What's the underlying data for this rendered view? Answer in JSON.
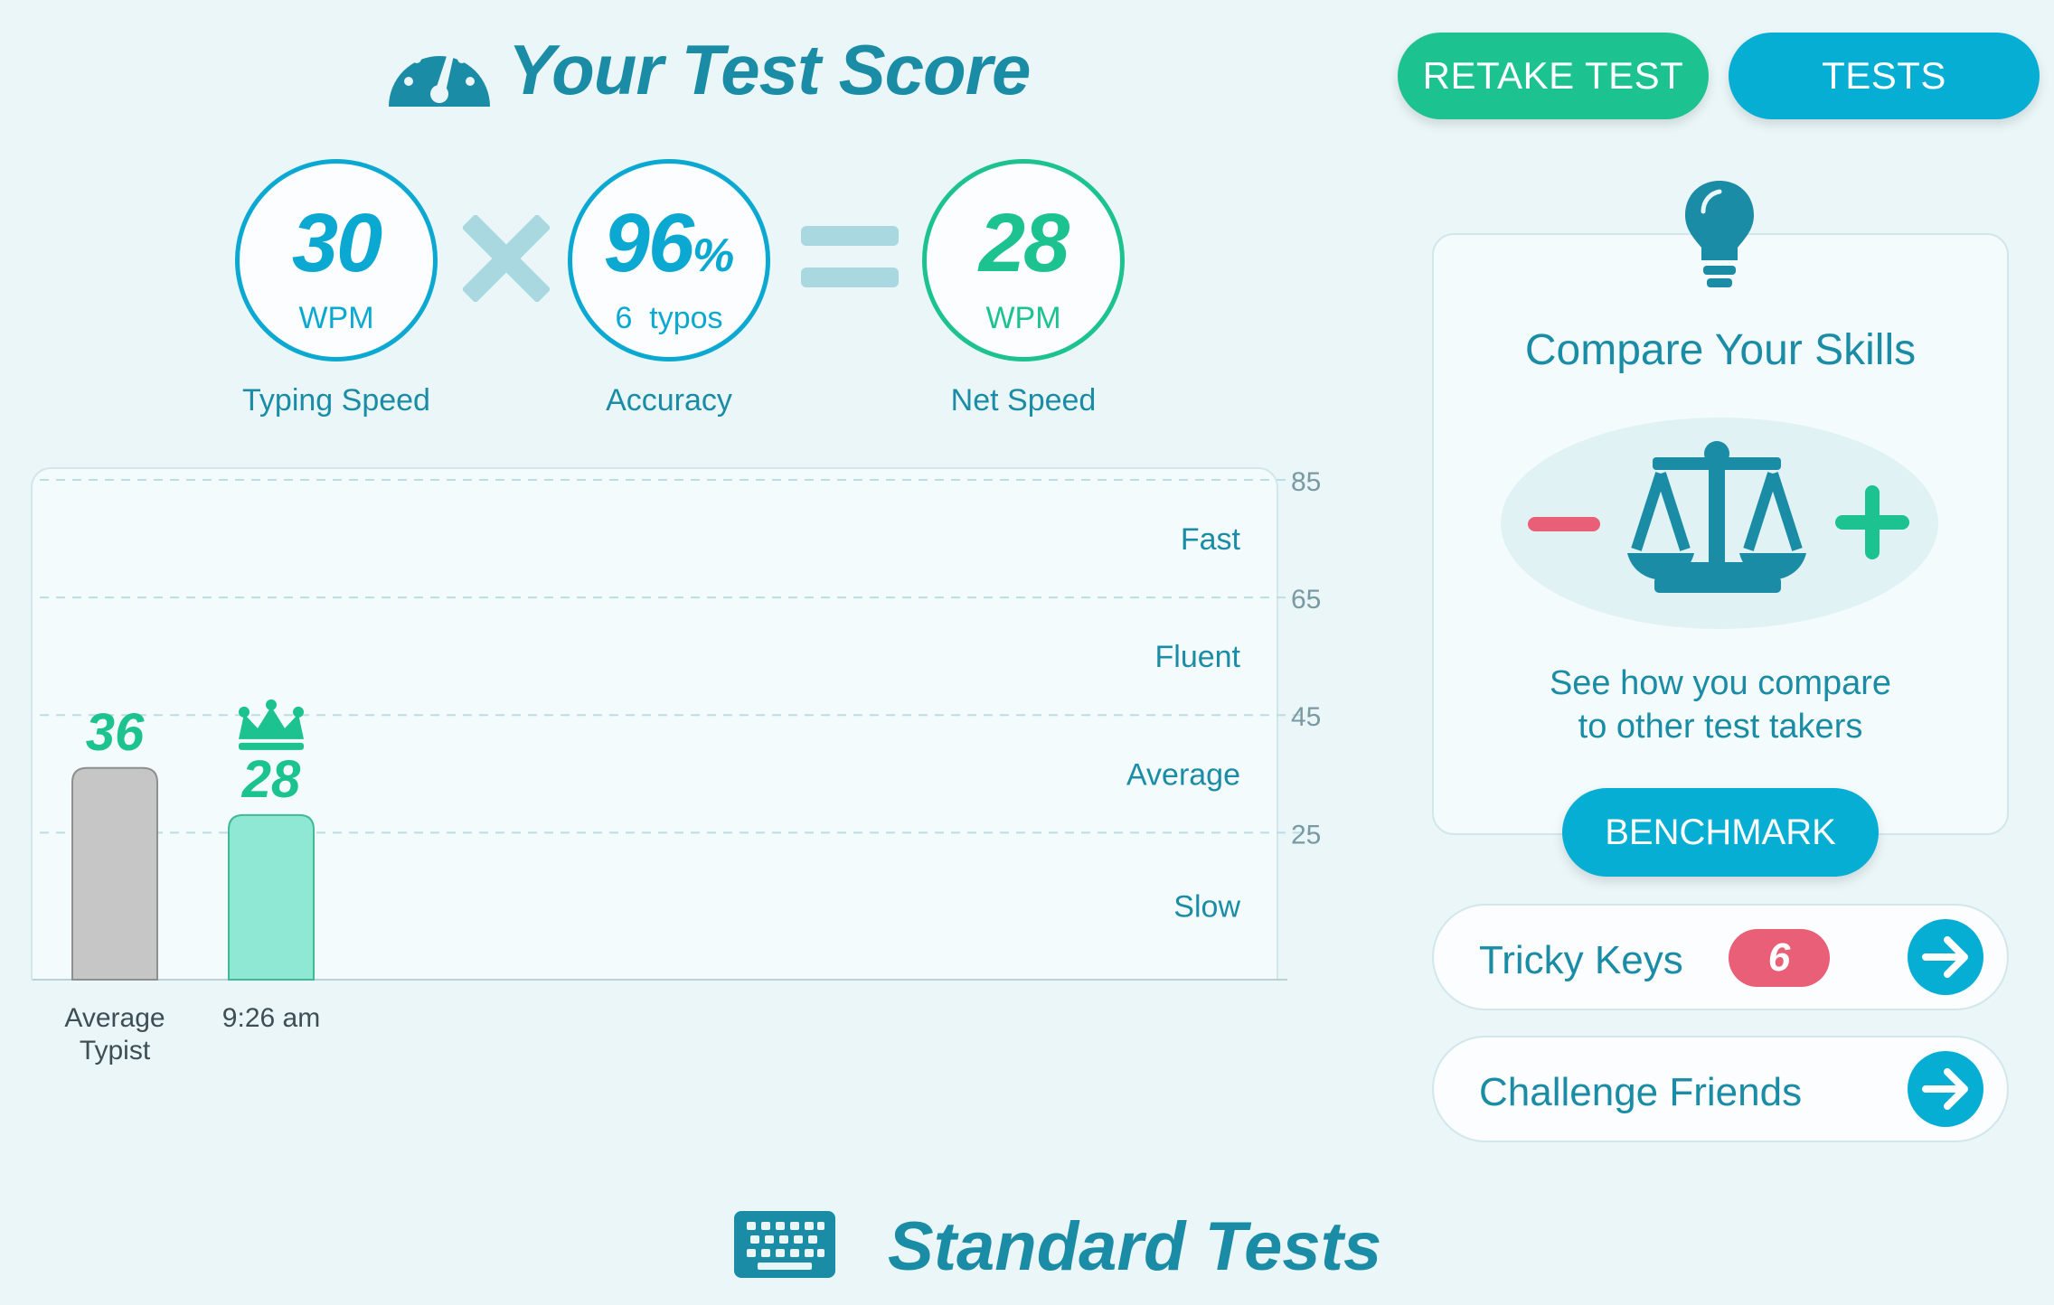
{
  "header": {
    "title": "Your Test Score",
    "retake_label": "RETAKE TEST",
    "tests_label": "TESTS"
  },
  "scores": {
    "speed": {
      "value": "30",
      "unit": "WPM",
      "label": "Typing Speed"
    },
    "accuracy": {
      "value": "96",
      "suffix": "%",
      "sub": "6  typos",
      "label": "Accuracy"
    },
    "net": {
      "value": "28",
      "unit": "WPM",
      "label": "Net Speed"
    }
  },
  "chart_data": {
    "type": "bar",
    "categories": [
      "Average\nTypist",
      "9:26 am"
    ],
    "values": [
      36,
      28
    ],
    "value_labels": [
      "36",
      "28"
    ],
    "bar_colors": [
      "#c6c6c6",
      "#8fe8d3"
    ],
    "ylim": [
      0,
      85
    ],
    "ticks": [
      85,
      65,
      45,
      25
    ],
    "zones": [
      {
        "label": "Fast",
        "y": 75
      },
      {
        "label": "Fluent",
        "y": 55
      },
      {
        "label": "Average",
        "y": 35
      },
      {
        "label": "Slow",
        "y": 12.5
      }
    ],
    "grid": "dashed",
    "best_marker": "crown-icon on 9:26 am"
  },
  "compare": {
    "title": "Compare Your Skills",
    "desc_line1": "See how you compare",
    "desc_line2": "to other test takers",
    "button": "BENCHMARK"
  },
  "tricky": {
    "label": "Tricky Keys",
    "count": "6"
  },
  "challenge": {
    "label": "Challenge Friends"
  },
  "footer": {
    "title": "Standard Tests"
  },
  "colors": {
    "primary": "#1a8ca5",
    "blue": "#07aed4",
    "green": "#1cc28f",
    "red": "#ea5f78",
    "background": "#eaf6f8"
  }
}
